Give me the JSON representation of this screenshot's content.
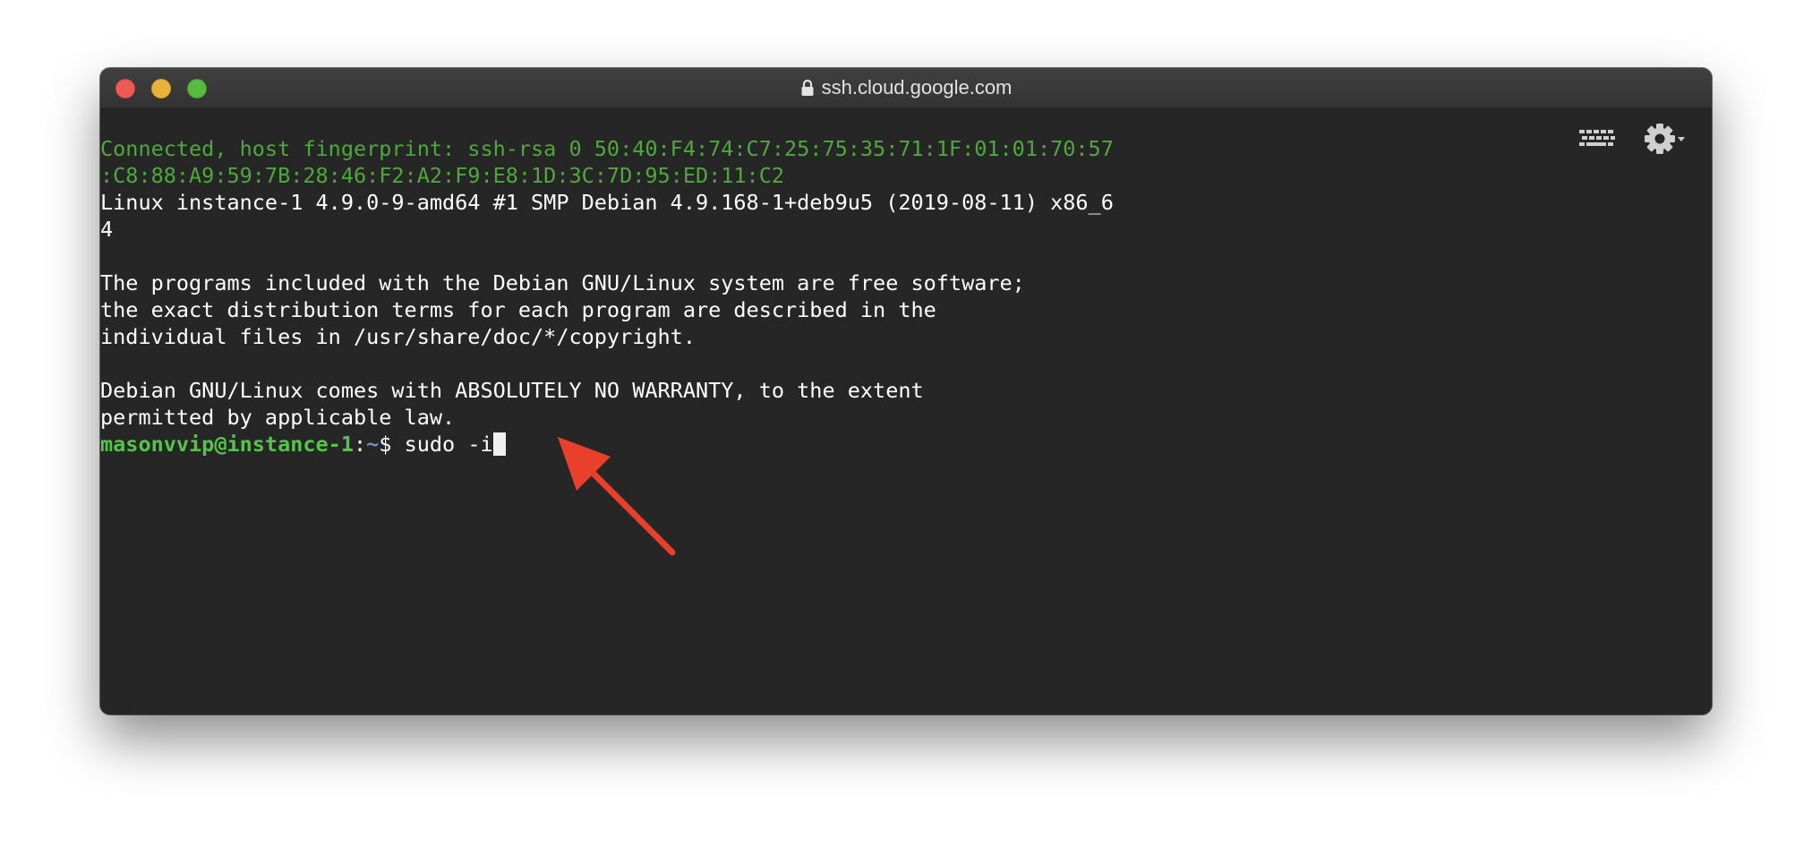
{
  "window": {
    "title": "ssh.cloud.google.com"
  },
  "toolbar": {
    "keyboard_icon": "keyboard-icon",
    "settings_icon": "gear-icon"
  },
  "terminal": {
    "connected_line_1": "Connected, host fingerprint: ssh-rsa 0 50:40:F4:74:C7:25:75:35:71:1F:01:01:70:57",
    "connected_line_2": ":C8:88:A9:59:7B:28:46:F2:A2:F9:E8:1D:3C:7D:95:ED:11:C2",
    "kernel_line_1": "Linux instance-1 4.9.0-9-amd64 #1 SMP Debian 4.9.168-1+deb9u5 (2019-08-11) x86_6",
    "kernel_line_2": "4",
    "motd_line_1": "The programs included with the Debian GNU/Linux system are free software;",
    "motd_line_2": "the exact distribution terms for each program are described in the",
    "motd_line_3": "individual files in /usr/share/doc/*/copyright.",
    "warranty_line_1": "Debian GNU/Linux comes with ABSOLUTELY NO WARRANTY, to the extent",
    "warranty_line_2": "permitted by applicable law.",
    "prompt": {
      "user_host": "masonvvip@instance-1",
      "colon": ":",
      "path": "~",
      "symbol": "$ ",
      "command": "sudo -i"
    }
  },
  "colors": {
    "background": "#262626",
    "green_text": "#4ea93c",
    "prompt_user": "#55c44a",
    "prompt_path": "#6f8ec3",
    "annotation_arrow": "#e8402a"
  }
}
